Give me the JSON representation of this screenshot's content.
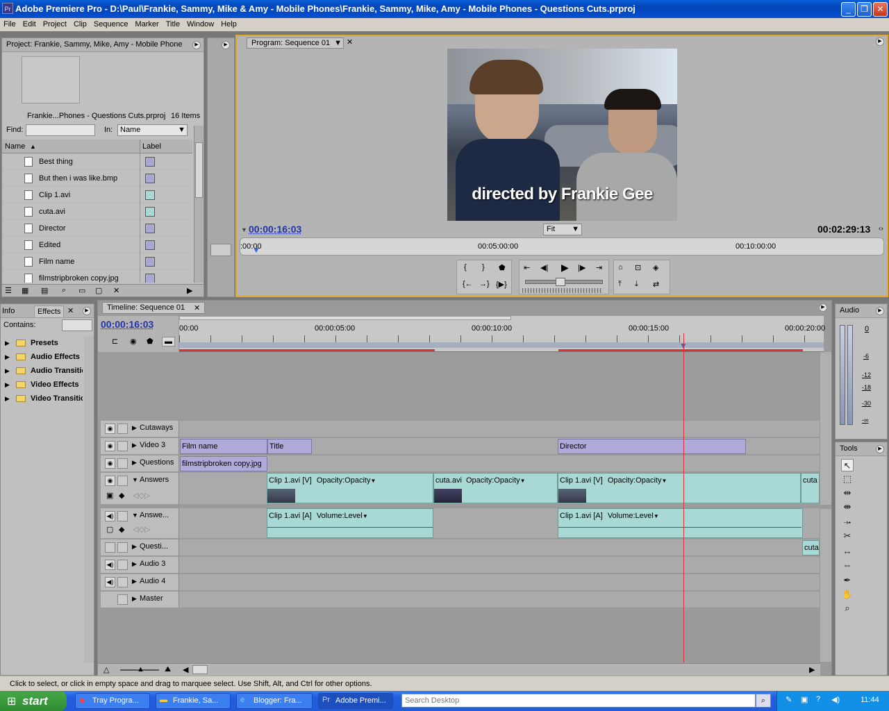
{
  "window": {
    "title": "Adobe Premiere Pro - D:\\Paul\\Frankie, Sammy, Mike & Amy - Mobile Phones\\Frankie, Sammy, Mike, Amy - Mobile Phones - Questions Cuts.prproj",
    "app_icon": "Pr"
  },
  "menu": [
    "File",
    "Edit",
    "Project",
    "Clip",
    "Sequence",
    "Marker",
    "Title",
    "Window",
    "Help"
  ],
  "project": {
    "tab": "Project: Frankie, Sammy, Mike, Amy - Mobile Phone",
    "file": "Frankie...Phones - Questions Cuts.prproj",
    "count": "16 Items",
    "find_label": "Find:",
    "in_label": "In:",
    "in_value": "Name",
    "col_name": "Name",
    "col_label": "Label",
    "items": [
      {
        "name": "Best thing",
        "color": "#a8a8d0"
      },
      {
        "name": "But then i was like.bmp",
        "color": "#a8a8d0"
      },
      {
        "name": "Clip 1.avi",
        "color": "#a8d8d0"
      },
      {
        "name": "cuta.avi",
        "color": "#a8d8d0"
      },
      {
        "name": "Director",
        "color": "#a8a8d0"
      },
      {
        "name": "Edited",
        "color": "#a8a8d0"
      },
      {
        "name": "Film name",
        "color": "#a8a8d0"
      },
      {
        "name": "filmstripbroken copy.jpg",
        "color": "#a8a8d0"
      }
    ]
  },
  "program": {
    "tab": "Program: Sequence 01",
    "caption": "directed by Frankie Gee",
    "current_time": "00:00:16:03",
    "duration": "00:02:29:13",
    "zoom": "Fit",
    "ruler": [
      ":00:00",
      "00:05:00:00",
      "00:10:00:00"
    ]
  },
  "effects": {
    "tab_info": "Info",
    "tab": "Effects",
    "contains_label": "Contains:",
    "folders": [
      "Presets",
      "Audio Effects",
      "Audio Transitions",
      "Video Effects",
      "Video Transitions"
    ]
  },
  "timeline": {
    "tab": "Timeline: Sequence 01",
    "current_time": "00:00:16:03",
    "ruler": [
      "00:00",
      "00:00:05:00",
      "00:00:10:00",
      "00:00:15:00",
      "00:00:20:00"
    ],
    "tracks": {
      "cutaways": "Cutaways",
      "video3": "Video 3",
      "questions": "Questions",
      "answers": "Answers",
      "answers_audio": "Answe...",
      "questions_audio": "Questi...",
      "audio3": "Audio 3",
      "audio4": "Audio 4",
      "master": "Master"
    },
    "clips": {
      "film_name": "Film name",
      "title": "Title",
      "director": "Director",
      "filmstrip": "filmstripbroken copy.jpg",
      "clip1_v": "Clip 1.avi [V]",
      "opacity": "Opacity:Opacity",
      "cuta": "cuta.avi",
      "cuta_short": "cuta",
      "clip1_a": "Clip 1.avi [A]",
      "volume": "Volume:Level"
    }
  },
  "audio_panel": {
    "tab": "Audio",
    "scale": [
      "0",
      "-6",
      "-12",
      "-18",
      "-30",
      "-∞"
    ]
  },
  "tools_panel": {
    "tab": "Tools"
  },
  "status_text": "Click to select, or click in empty space and drag to marquee select. Use Shift, Alt, and Ctrl for other options.",
  "taskbar": {
    "start": "start",
    "buttons": [
      "Tray Progra...",
      "Frankie, Sa...",
      "Blogger: Fra...",
      "Adobe Premi..."
    ],
    "search_placeholder": "Search Desktop",
    "clock": "11:44"
  }
}
